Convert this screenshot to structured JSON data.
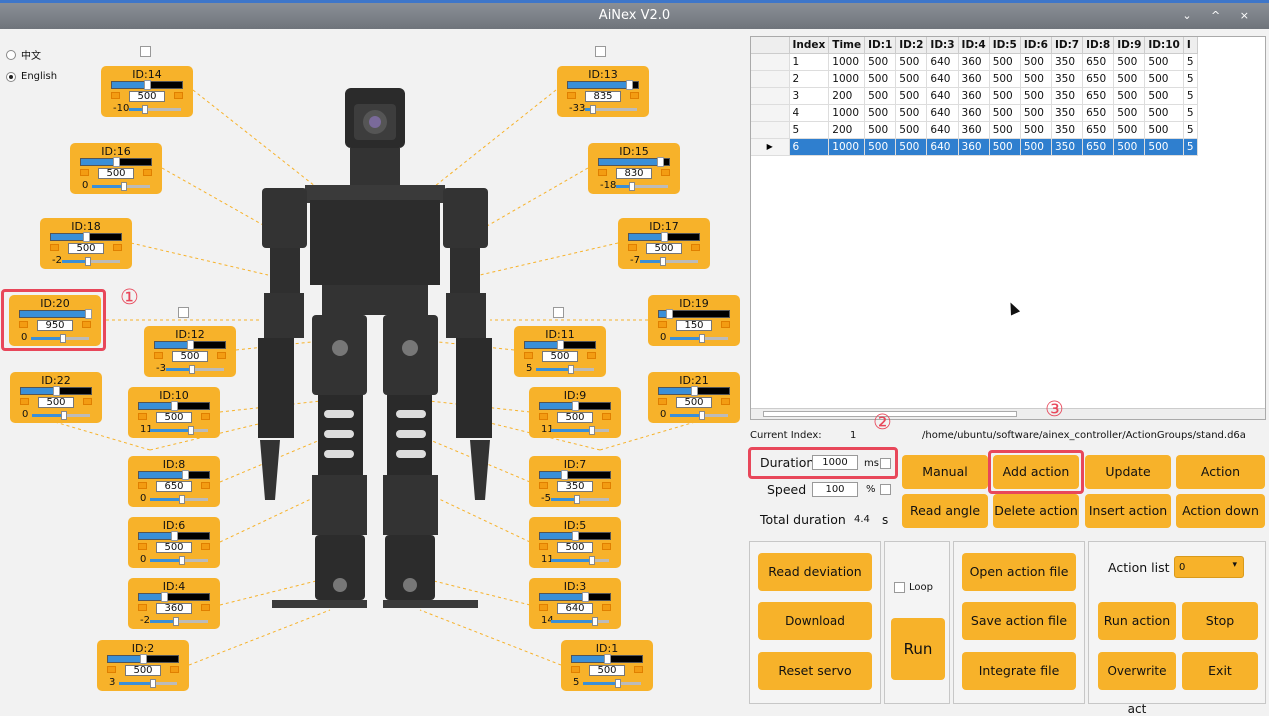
{
  "window": {
    "title": "AiNex V2.0",
    "controls": "⌄ ^ ×"
  },
  "language": {
    "options": [
      "中文",
      "English"
    ],
    "selected": "English"
  },
  "servos": [
    {
      "id": "ID:14",
      "value": "500",
      "dev": "-10",
      "pos": 0.5,
      "devpos": 0.3
    },
    {
      "id": "ID:13",
      "value": "835",
      "dev": "-33",
      "pos": 0.86,
      "devpos": 0.15
    },
    {
      "id": "ID:16",
      "value": "500",
      "dev": "0",
      "pos": 0.5,
      "devpos": 0.55
    },
    {
      "id": "ID:15",
      "value": "830",
      "dev": "-18",
      "pos": 0.86,
      "devpos": 0.3
    },
    {
      "id": "ID:18",
      "value": "500",
      "dev": "-2",
      "pos": 0.5,
      "devpos": 0.45
    },
    {
      "id": "ID:17",
      "value": "500",
      "dev": "-7",
      "pos": 0.5,
      "devpos": 0.4
    },
    {
      "id": "ID:20",
      "value": "950",
      "dev": "0",
      "pos": 0.96,
      "devpos": 0.55
    },
    {
      "id": "ID:19",
      "value": "150",
      "dev": "0",
      "pos": 0.15,
      "devpos": 0.55
    },
    {
      "id": "ID:12",
      "value": "500",
      "dev": "-3",
      "pos": 0.5,
      "devpos": 0.45
    },
    {
      "id": "ID:11",
      "value": "500",
      "dev": "5",
      "pos": 0.5,
      "devpos": 0.6
    },
    {
      "id": "ID:22",
      "value": "500",
      "dev": "0",
      "pos": 0.5,
      "devpos": 0.55
    },
    {
      "id": "ID:21",
      "value": "500",
      "dev": "0",
      "pos": 0.5,
      "devpos": 0.55
    },
    {
      "id": "ID:10",
      "value": "500",
      "dev": "11",
      "pos": 0.5,
      "devpos": 0.7
    },
    {
      "id": "ID:9",
      "value": "500",
      "dev": "11",
      "pos": 0.5,
      "devpos": 0.7
    },
    {
      "id": "ID:8",
      "value": "650",
      "dev": "0",
      "pos": 0.65,
      "devpos": 0.55
    },
    {
      "id": "ID:7",
      "value": "350",
      "dev": "-5",
      "pos": 0.35,
      "devpos": 0.45
    },
    {
      "id": "ID:6",
      "value": "500",
      "dev": "0",
      "pos": 0.5,
      "devpos": 0.55
    },
    {
      "id": "ID:5",
      "value": "500",
      "dev": "11",
      "pos": 0.5,
      "devpos": 0.7
    },
    {
      "id": "ID:4",
      "value": "360",
      "dev": "-2",
      "pos": 0.36,
      "devpos": 0.45
    },
    {
      "id": "ID:3",
      "value": "640",
      "dev": "14",
      "pos": 0.64,
      "devpos": 0.75
    },
    {
      "id": "ID:2",
      "value": "500",
      "dev": "3",
      "pos": 0.5,
      "devpos": 0.58
    },
    {
      "id": "ID:1",
      "value": "500",
      "dev": "5",
      "pos": 0.5,
      "devpos": 0.6
    }
  ],
  "table": {
    "columns": [
      "Index",
      "Time",
      "ID:1",
      "ID:2",
      "ID:3",
      "ID:4",
      "ID:5",
      "ID:6",
      "ID:7",
      "ID:8",
      "ID:9",
      "ID:10",
      "I"
    ],
    "rows": [
      [
        "1",
        "1000",
        "500",
        "500",
        "640",
        "360",
        "500",
        "500",
        "350",
        "650",
        "500",
        "500",
        "5"
      ],
      [
        "2",
        "1000",
        "500",
        "500",
        "640",
        "360",
        "500",
        "500",
        "350",
        "650",
        "500",
        "500",
        "5"
      ],
      [
        "3",
        "200",
        "500",
        "500",
        "640",
        "360",
        "500",
        "500",
        "350",
        "650",
        "500",
        "500",
        "5"
      ],
      [
        "4",
        "1000",
        "500",
        "500",
        "640",
        "360",
        "500",
        "500",
        "350",
        "650",
        "500",
        "500",
        "5"
      ],
      [
        "5",
        "200",
        "500",
        "500",
        "640",
        "360",
        "500",
        "500",
        "350",
        "650",
        "500",
        "500",
        "5"
      ],
      [
        "6",
        "1000",
        "500",
        "500",
        "640",
        "360",
        "500",
        "500",
        "350",
        "650",
        "500",
        "500",
        "5"
      ]
    ],
    "selected_row": 5,
    "row_marker": "▶"
  },
  "status": {
    "current_index_label": "Current Index:",
    "current_index": "1",
    "file_path": "/home/ubuntu/software/ainex_controller/ActionGroups/stand.d6a"
  },
  "settings": {
    "duration_label": "Duration",
    "duration_value": "1000",
    "duration_unit": "ms",
    "speed_label": "Speed",
    "speed_value": "100",
    "speed_unit": "%",
    "total_label": "Total duration",
    "total_value": "4.4",
    "total_unit": "s"
  },
  "action_buttons": {
    "manual": "Manual",
    "add": "Add action",
    "update": "Update action",
    "upward": "Action upward",
    "read_angle": "Read angle",
    "delete": "Delete action",
    "insert": "Insert action",
    "down": "Action down"
  },
  "deviation": {
    "read": "Read deviation",
    "download": "Download deviation",
    "reset": "Reset servo"
  },
  "run": {
    "loop_label": "Loop",
    "run_label": "Run"
  },
  "files": {
    "open": "Open action file",
    "save": "Save action file",
    "integrate": "Integrate file"
  },
  "action_list": {
    "label": "Action list",
    "selected": "0",
    "run": "Run action",
    "stop": "Stop",
    "overwrite": "Overwrite act",
    "exit": "Exit"
  },
  "annotations": [
    "①",
    "②",
    "③"
  ],
  "colors": {
    "accent": "#f7b22a",
    "highlight": "#e8475a",
    "selection": "#2f7fcf"
  }
}
